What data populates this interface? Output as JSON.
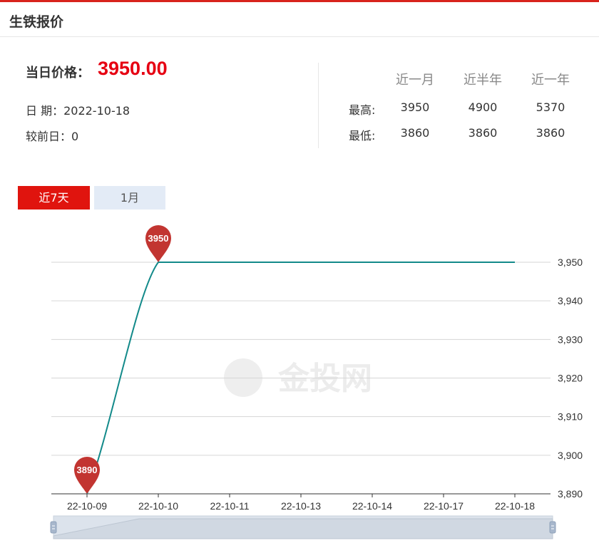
{
  "header": {
    "title": "生铁报价"
  },
  "summary": {
    "price_label": "当日价格：",
    "price_value": "3950.00",
    "date_text": "日 期：2022-10-18",
    "change_text": "较前日：0"
  },
  "stats": {
    "columns": [
      "近一月",
      "近半年",
      "近一年"
    ],
    "rows": [
      {
        "label": "最高:",
        "values": [
          "3950",
          "4900",
          "5370"
        ]
      },
      {
        "label": "最低:",
        "values": [
          "3860",
          "3860",
          "3860"
        ]
      }
    ]
  },
  "tabs": [
    {
      "label": "近7天",
      "active": true
    },
    {
      "label": "1月",
      "active": false
    }
  ],
  "watermark": {
    "text": "金投网"
  },
  "colors": {
    "accent": "#e0140e",
    "line": "#138a8a",
    "pin": "#c23531",
    "tab_inactive": "#e3ebf6"
  },
  "chart_data": {
    "type": "line",
    "categories": [
      "22-10-09",
      "22-10-10",
      "22-10-11",
      "22-10-13",
      "22-10-14",
      "22-10-17",
      "22-10-18"
    ],
    "values": [
      3890,
      3950,
      3950,
      3950,
      3950,
      3950,
      3950
    ],
    "ylim": [
      3890,
      3950
    ],
    "yticks": [
      3890,
      3900,
      3910,
      3920,
      3930,
      3940,
      3950
    ],
    "ytick_labels": [
      "3,890",
      "3,900",
      "3,910",
      "3,920",
      "3,930",
      "3,940",
      "3,950"
    ],
    "markers": [
      {
        "category": "22-10-10",
        "value": 3950,
        "label": "3950"
      },
      {
        "category": "22-10-09",
        "value": 3890,
        "label": "3890"
      }
    ],
    "yaxis_position": "right",
    "grid": true,
    "datazoom": true
  }
}
